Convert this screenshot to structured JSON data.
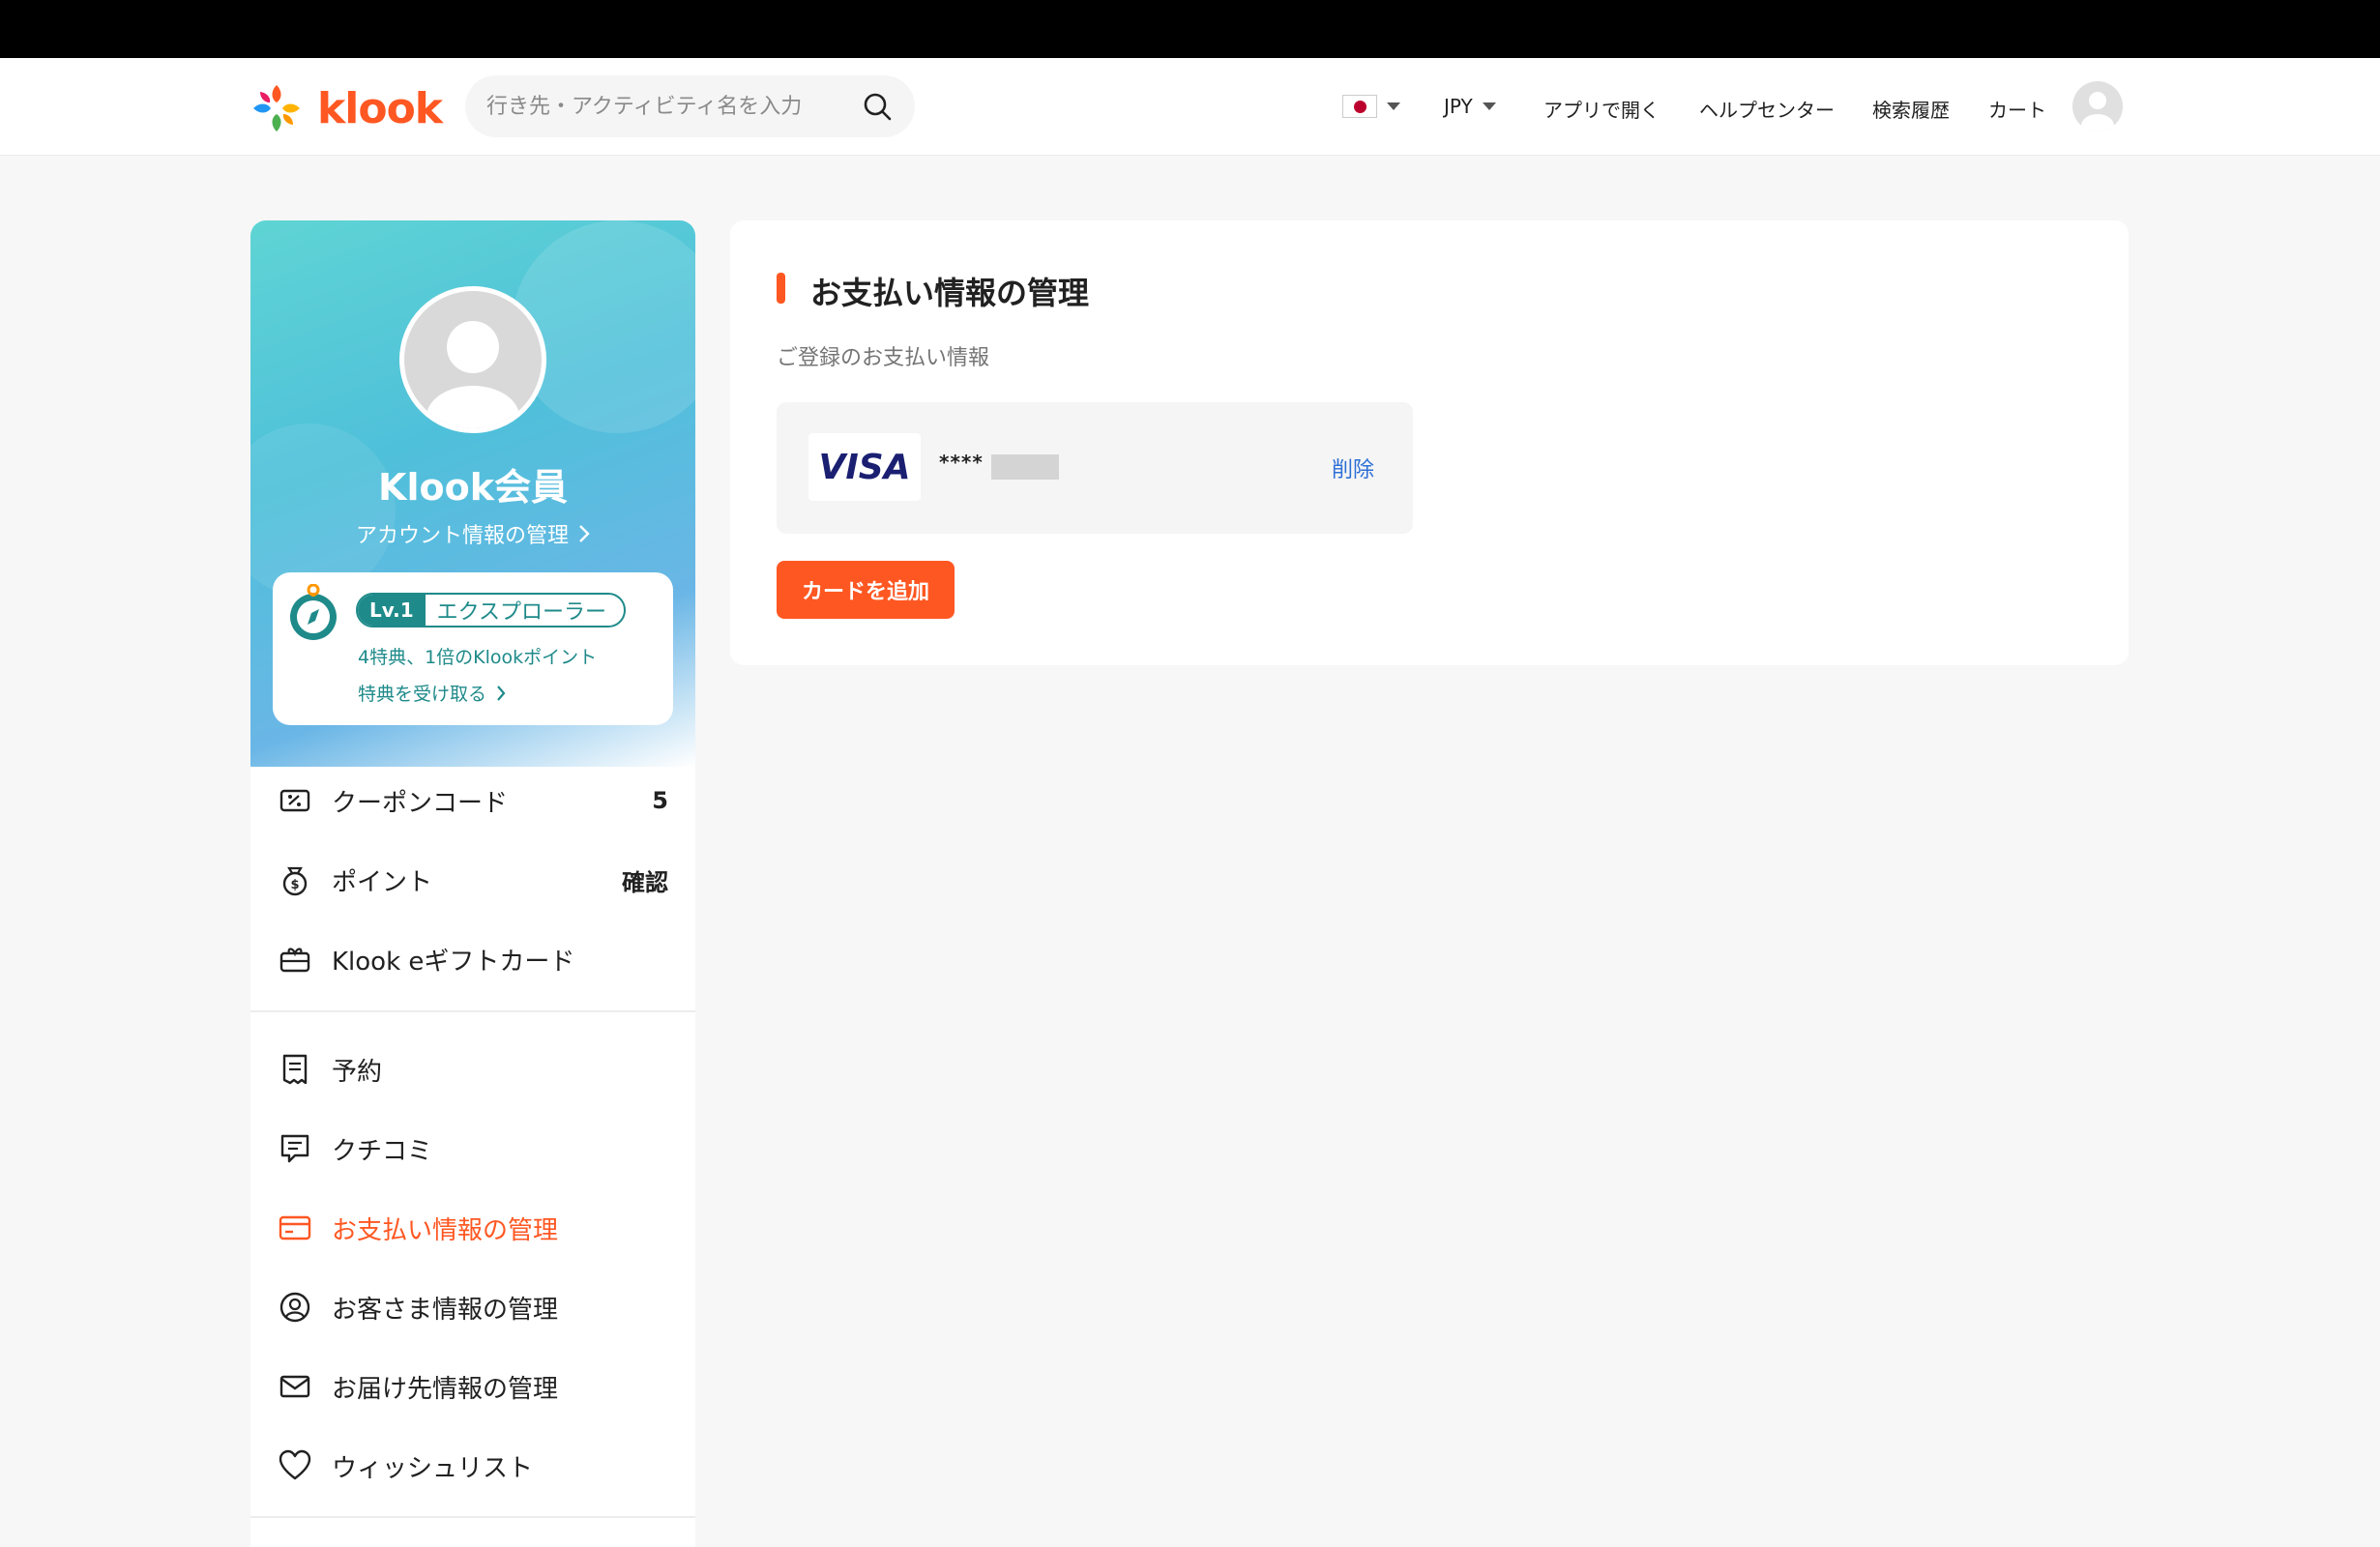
{
  "header": {
    "brand": "klook",
    "search_placeholder": "行き先・アクティビティ名を入力",
    "currency": "JPY",
    "nav_open_app": "アプリで開く",
    "nav_help": "ヘルプセンター",
    "nav_history": "検索履歴",
    "nav_cart": "カート",
    "colors": {
      "brand": "#ff5722"
    }
  },
  "profile": {
    "name": "Klook会員",
    "account_link": "アカウント情報の管理",
    "level_label": "Lv.1",
    "level_name": "エクスプローラー",
    "level_desc": "4特典、1倍のKlookポイント",
    "benefit_link": "特典を受け取る"
  },
  "sidebar": {
    "group1": [
      {
        "label": "クーポンコード",
        "badge": "5",
        "icon": "coupon-icon"
      },
      {
        "label": "ポイント",
        "badge": "確認",
        "icon": "points-icon"
      },
      {
        "label": "Klook eギフトカード",
        "badge": "",
        "icon": "gift-card-icon"
      }
    ],
    "group2": [
      {
        "label": "予約",
        "icon": "booking-icon"
      },
      {
        "label": "クチコミ",
        "icon": "review-icon"
      },
      {
        "label": "お支払い情報の管理",
        "icon": "payment-card-icon",
        "active": true
      },
      {
        "label": "お客さま情報の管理",
        "icon": "user-icon"
      },
      {
        "label": "お届け先情報の管理",
        "icon": "mail-icon"
      },
      {
        "label": "ウィッシュリスト",
        "icon": "heart-icon"
      }
    ]
  },
  "main": {
    "title": "お支払い情報の管理",
    "section_label": "ご登録のお支払い情報",
    "card": {
      "brand": "VISA",
      "number_prefix": "****"
    },
    "delete_label": "削除",
    "add_card_label": "カードを追加"
  }
}
